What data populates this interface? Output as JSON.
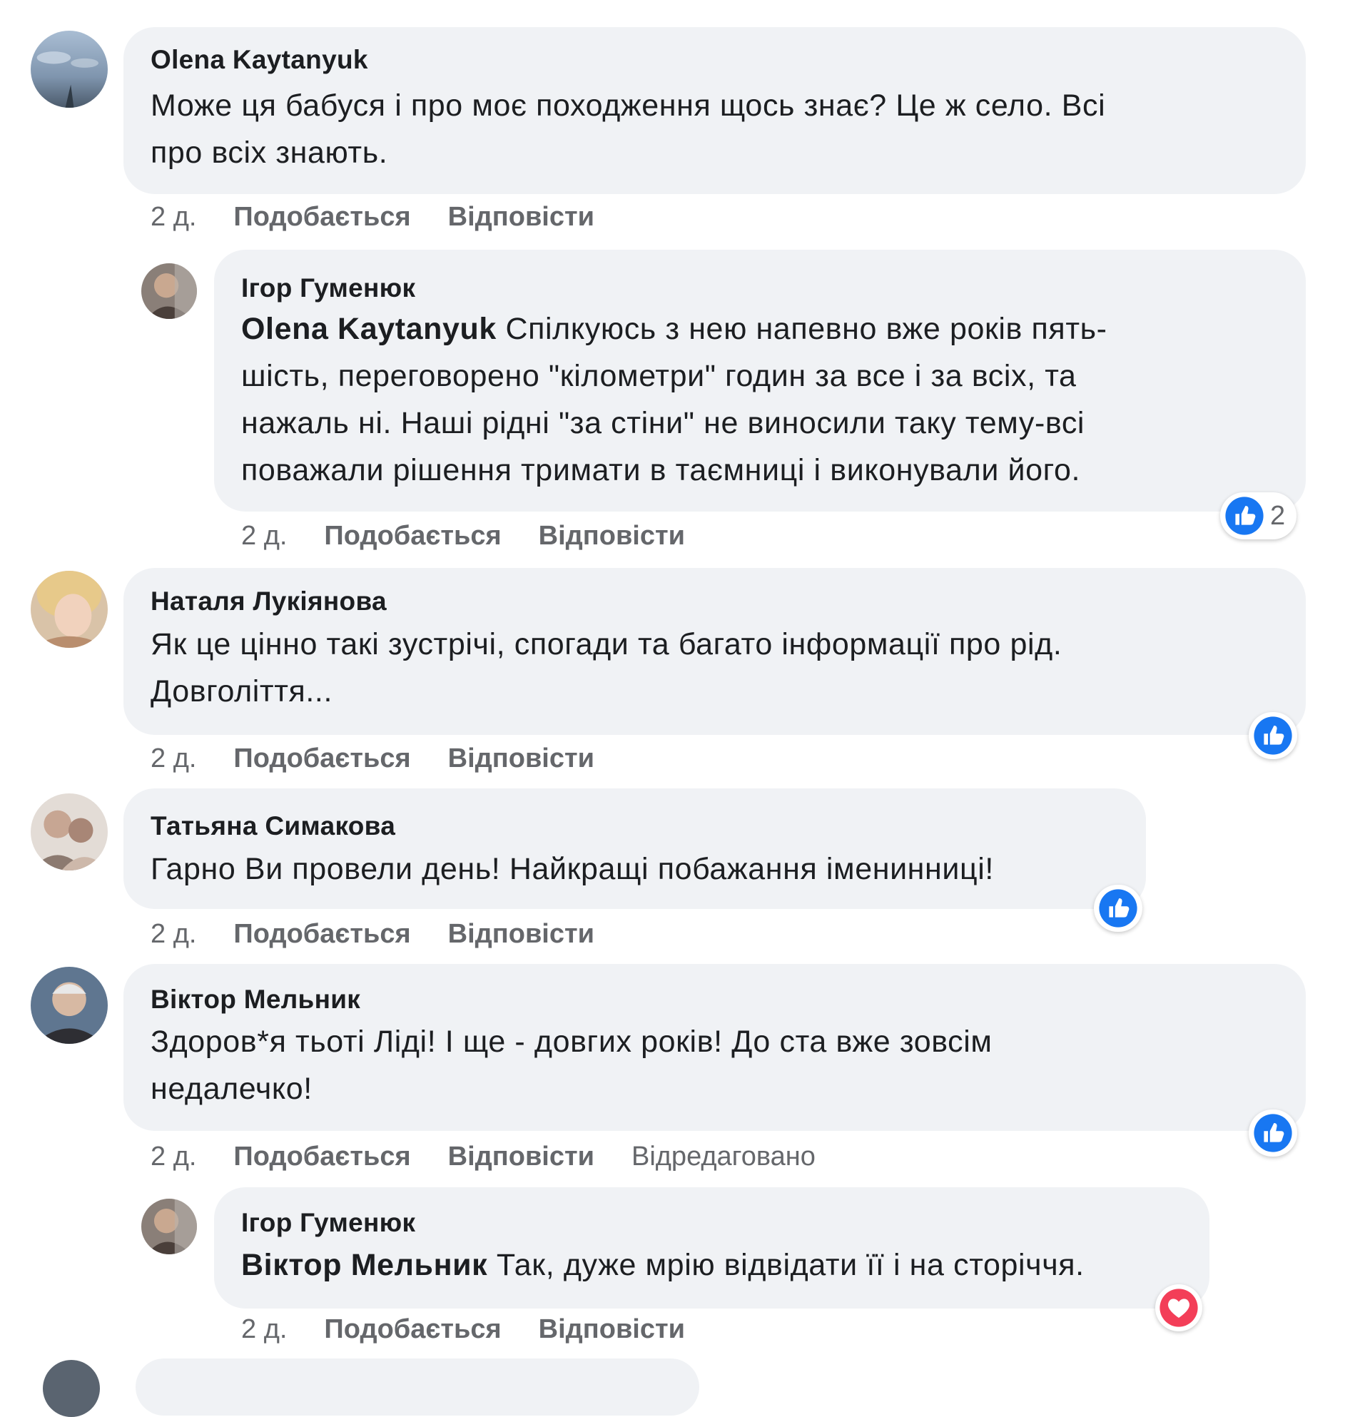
{
  "comments": [
    {
      "author": "Olena Kaytanyuk",
      "lines": [
        "Може ця бабуся і про моє походження щось знає? Це ж село. Всі",
        "про всіх знають."
      ],
      "time": "2 д.",
      "like_label": "Подобається",
      "reply_label": "Відповісти"
    },
    {
      "author": "Ігор Гуменюк",
      "mention": "Olena Kaytanyuk",
      "lines": [
        " Спілкуюсь з нею напевно вже років пять-",
        "шість, переговорено \"кілометри\" годин за все і за всіх, та",
        "нажаль ні. Наші рідні \"за стіни\" не виносили таку тему-всі",
        "поважали рішення тримати в таємниці і виконували його."
      ],
      "time": "2 д.",
      "like_label": "Подобається",
      "reply_label": "Відповісти",
      "reaction": {
        "icon": "like-icon",
        "count": "2"
      }
    },
    {
      "author": "Наталя Лукіянова",
      "lines": [
        "Як це цінно такі зустрічі, спогади та багато інформації про рід.",
        "Довголіття..."
      ],
      "time": "2 д.",
      "like_label": "Подобається",
      "reply_label": "Відповісти",
      "reaction": {
        "icon": "like-icon"
      }
    },
    {
      "author": "Татьяна Симакова",
      "lines": [
        "Гарно Ви провели день! Найкращі побажання іменинниці!"
      ],
      "time": "2 д.",
      "like_label": "Подобається",
      "reply_label": "Відповісти",
      "reaction": {
        "icon": "like-icon"
      }
    },
    {
      "author": "Віктор Мельник",
      "lines": [
        "Здоров*я тьоті Ліді! І ще - довгих років! До ста вже зовсім",
        "недалечко!"
      ],
      "time": "2 д.",
      "like_label": "Подобається",
      "reply_label": "Відповісти",
      "edited_label": "Відредаговано",
      "reaction": {
        "icon": "like-icon"
      }
    },
    {
      "author": "Ігор Гуменюк",
      "mention": "Віктор Мельник",
      "lines": [
        " Так, дуже мрію відвідати її і на сторіччя."
      ],
      "time": "2 д.",
      "like_label": "Подобається",
      "reply_label": "Відповісти",
      "reaction": {
        "icon": "heart-icon"
      }
    }
  ],
  "colors": {
    "bubble": "#f0f2f5",
    "meta_text": "#65676b",
    "like_blue": "#1877f2",
    "heart_red": "#f33e58"
  }
}
